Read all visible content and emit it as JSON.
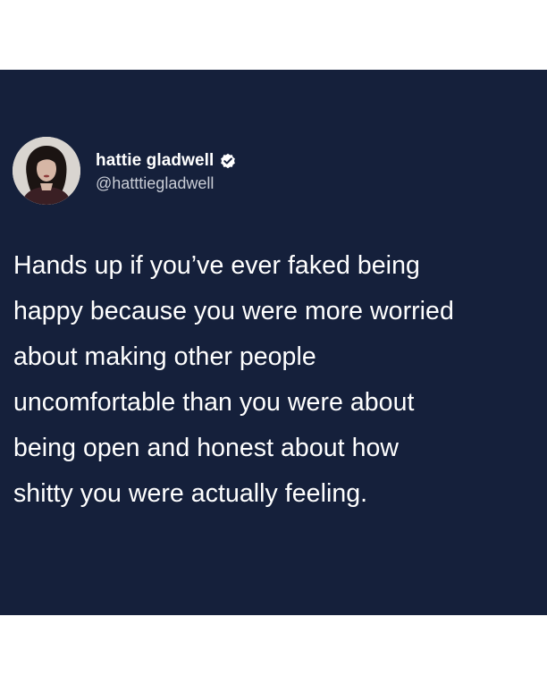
{
  "author": {
    "display_name": "hattie gladwell",
    "handle": "@hatttiegladwell",
    "avatar_icon": "profile-photo",
    "verified_icon": "verified-badge-icon"
  },
  "tweet": {
    "text": "Hands up if you’ve ever faked being\nhappy because you were more worried\nabout making other people\nuncomfortable than you were about\nbeing open and honest about how\nshitty you were actually feeling."
  },
  "colors": {
    "card_background": "#15203b",
    "text": "#ffffff",
    "handle_text": "#c9cdd6"
  }
}
